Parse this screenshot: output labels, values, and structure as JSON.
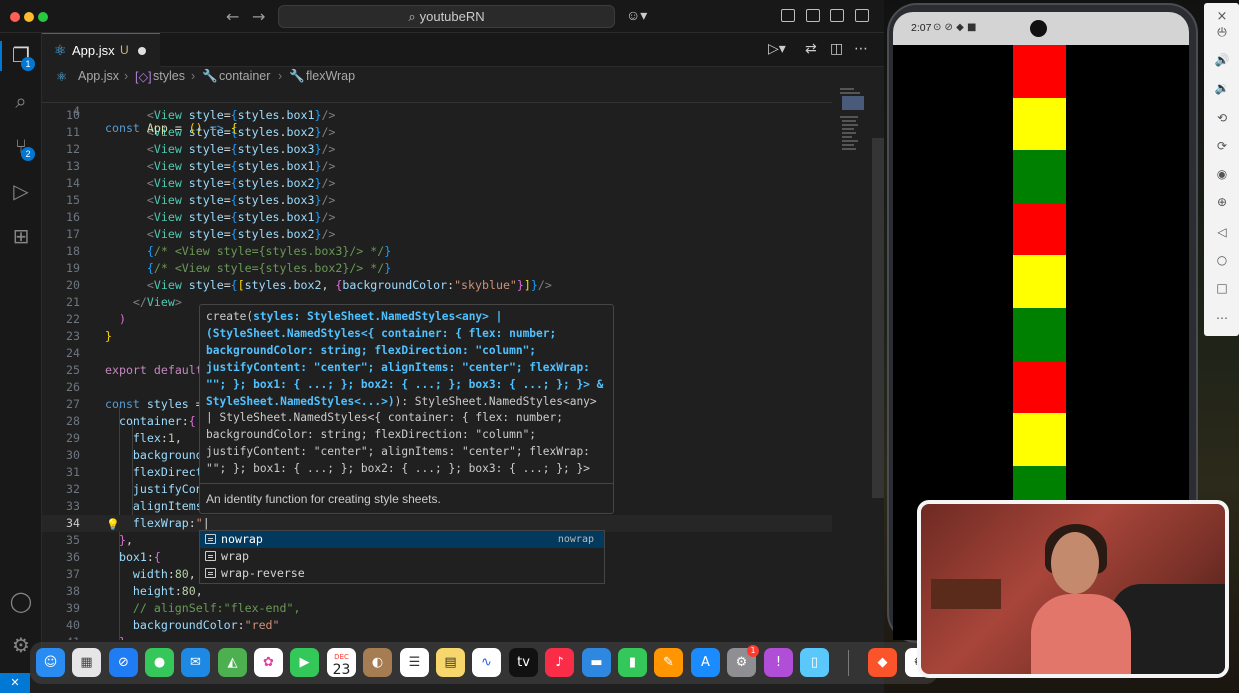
{
  "titlebar": {
    "search_text": "youtubeRN",
    "back_arrow": "←",
    "forward_arrow": "→"
  },
  "activity": {
    "explorer_badge": "1",
    "scm_badge": "2"
  },
  "tab": {
    "filename": "App.jsx",
    "status": "U"
  },
  "breadcrumb": [
    "App.jsx",
    "styles",
    "container",
    "flexWrap"
  ],
  "code": {
    "sticky": {
      "num": "4",
      "html": "<span class='kw'>const</span> <span class='fn'>App</span> <span class='plain'>=</span> <span class='br1'>(</span><span class='br1'>)</span> <span class='kw'>=&gt;</span> <span class='br1'>{</span>"
    },
    "lines": [
      {
        "num": "10",
        "html": "      <span class='pun'>&lt;</span><span class='tag'>View</span> <span class='var'>style</span><span class='plain'>=</span><span class='br3'>{</span><span class='var'>styles</span><span class='plain'>.</span><span class='var'>box1</span><span class='br3'>}</span><span class='pun'>/&gt;</span>"
      },
      {
        "num": "11",
        "html": "      <span class='pun'>&lt;</span><span class='tag'>View</span> <span class='var'>style</span><span class='plain'>=</span><span class='br3'>{</span><span class='var'>styles</span><span class='plain'>.</span><span class='var'>box2</span><span class='br3'>}</span><span class='pun'>/&gt;</span>"
      },
      {
        "num": "12",
        "html": "      <span class='pun'>&lt;</span><span class='tag'>View</span> <span class='var'>style</span><span class='plain'>=</span><span class='br3'>{</span><span class='var'>styles</span><span class='plain'>.</span><span class='var'>box3</span><span class='br3'>}</span><span class='pun'>/&gt;</span>"
      },
      {
        "num": "13",
        "html": "      <span class='pun'>&lt;</span><span class='tag'>View</span> <span class='var'>style</span><span class='plain'>=</span><span class='br3'>{</span><span class='var'>styles</span><span class='plain'>.</span><span class='var'>box1</span><span class='br3'>}</span><span class='pun'>/&gt;</span>"
      },
      {
        "num": "14",
        "html": "      <span class='pun'>&lt;</span><span class='tag'>View</span> <span class='var'>style</span><span class='plain'>=</span><span class='br3'>{</span><span class='var'>styles</span><span class='plain'>.</span><span class='var'>box2</span><span class='br3'>}</span><span class='pun'>/&gt;</span>"
      },
      {
        "num": "15",
        "html": "      <span class='pun'>&lt;</span><span class='tag'>View</span> <span class='var'>style</span><span class='plain'>=</span><span class='br3'>{</span><span class='var'>styles</span><span class='plain'>.</span><span class='var'>box3</span><span class='br3'>}</span><span class='pun'>/&gt;</span>"
      },
      {
        "num": "16",
        "html": "      <span class='pun'>&lt;</span><span class='tag'>View</span> <span class='var'>style</span><span class='plain'>=</span><span class='br3'>{</span><span class='var'>styles</span><span class='plain'>.</span><span class='var'>box1</span><span class='br3'>}</span><span class='pun'>/&gt;</span>"
      },
      {
        "num": "17",
        "html": "      <span class='pun'>&lt;</span><span class='tag'>View</span> <span class='var'>style</span><span class='plain'>=</span><span class='br3'>{</span><span class='var'>styles</span><span class='plain'>.</span><span class='var'>box2</span><span class='br3'>}</span><span class='pun'>/&gt;</span>"
      },
      {
        "num": "18",
        "html": "      <span class='br3'>{</span><span class='cmt'>/* &lt;View style={styles.box3}/&gt; */</span><span class='br3'>}</span>"
      },
      {
        "num": "19",
        "html": "      <span class='br3'>{</span><span class='cmt'>/* &lt;View style={styles.box2}/&gt; */</span><span class='br3'>}</span>"
      },
      {
        "num": "20",
        "html": "      <span class='pun'>&lt;</span><span class='tag'>View</span> <span class='var'>style</span><span class='plain'>=</span><span class='br3'>{</span><span class='br1'>[</span><span class='var'>styles</span><span class='plain'>.</span><span class='var'>box2</span><span class='plain'>, </span><span class='br2'>{</span><span class='var'>backgroundColor</span><span class='plain'>:</span><span class='str'>\"skyblue\"</span><span class='br2'>}</span><span class='br1'>]</span><span class='br3'>}</span><span class='pun'>/&gt;</span>"
      },
      {
        "num": "21",
        "html": "    <span class='pun'>&lt;/</span><span class='tag'>View</span><span class='pun'>&gt;</span>"
      },
      {
        "num": "22",
        "html": "  <span class='br2'>)</span>"
      },
      {
        "num": "23",
        "html": "<span class='br1'>}</span>"
      },
      {
        "num": "24",
        "html": ""
      },
      {
        "num": "25",
        "html": "<span class='ctl'>export</span> <span class='ctl'>default</span>"
      },
      {
        "num": "26",
        "html": ""
      },
      {
        "num": "27",
        "html": "<span class='kw'>const</span> <span class='var'>styles</span> <span class='plain'>=</span>"
      },
      {
        "num": "28",
        "html": "  <span class='var'>container</span><span class='plain'>:</span><span class='br2'>{</span>"
      },
      {
        "num": "29",
        "html": "    <span class='var'>flex</span><span class='plain'>:</span><span class='num'>1</span><span class='plain'>,</span>"
      },
      {
        "num": "30",
        "html": "    <span class='var'>background</span>"
      },
      {
        "num": "31",
        "html": "    <span class='var'>flexDirect</span>"
      },
      {
        "num": "32",
        "html": "    <span class='var'>justifyCon</span>"
      },
      {
        "num": "33",
        "html": "    <span class='var'>alignItems</span>"
      },
      {
        "num": "34",
        "html": "    <span class='var'>flexWrap</span><span class='plain'>:</span><span class='str'>\"</span><span class='plain'>|</span>"
      },
      {
        "num": "35",
        "html": "  <span class='br2'>}</span><span class='plain'>,</span>"
      },
      {
        "num": "36",
        "html": "  <span class='var'>box1</span><span class='plain'>:</span><span class='br2'>{</span>"
      },
      {
        "num": "37",
        "html": "    <span class='var'>width</span><span class='plain'>:</span><span class='num'>80</span><span class='plain'>,</span>"
      },
      {
        "num": "38",
        "html": "    <span class='var'>height</span><span class='plain'>:</span><span class='num'>80</span><span class='plain'>,</span>"
      },
      {
        "num": "39",
        "html": "    <span class='cmt'>// alignSelf:\"flex-end\",</span>"
      },
      {
        "num": "40",
        "html": "    <span class='var'>backgroundColor</span><span class='plain'>:</span><span class='str'>\"red\"</span>"
      },
      {
        "num": "41",
        "html": "  <span class='br2'>}</span><span class='plain'>,</span>"
      }
    ]
  },
  "hover": {
    "signature_html": "create(<b>styles: StyleSheet.NamedStyles&lt;any&gt; | (StyleSheet.NamedStyles&lt;{ container: { flex: number; backgroundColor: string; flexDirection: \"column\"; justifyContent: \"center\"; alignItems: \"center\"; flexWrap: \"\"; }; box1: { ...; }; box2: { ...; }; box3: { ...; }; }&gt; &amp; StyleSheet.NamedStyles&lt;...&gt;)</b>): StyleSheet.NamedStyles&lt;any&gt; | StyleSheet.NamedStyles&lt;{ container: { flex: number; backgroundColor: string; flexDirection: \"column\"; justifyContent: \"center\"; alignItems: \"center\"; flexWrap: \"\"; }; box1: { ...; }; box2: { ...; }; box3: { ...; }; }&gt;",
    "doc": "An identity function for creating style sheets."
  },
  "suggest": {
    "items": [
      {
        "label": "nowrap",
        "detail": "nowrap"
      },
      {
        "label": "wrap",
        "detail": ""
      },
      {
        "label": "wrap-reverse",
        "detail": ""
      }
    ]
  },
  "phone": {
    "time": "2:07",
    "box_colors": [
      "#ff0000",
      "#ffff00",
      "#008000",
      "#ff0000",
      "#ffff00",
      "#008000",
      "#ff0000",
      "#ffff00",
      "#008000"
    ]
  },
  "dock": {
    "calendar_month": "DEC",
    "calendar_day": "23",
    "settings_badge": "1"
  },
  "colors": {
    "accent": "#0078d4",
    "editor_bg": "#1f1f1f"
  }
}
